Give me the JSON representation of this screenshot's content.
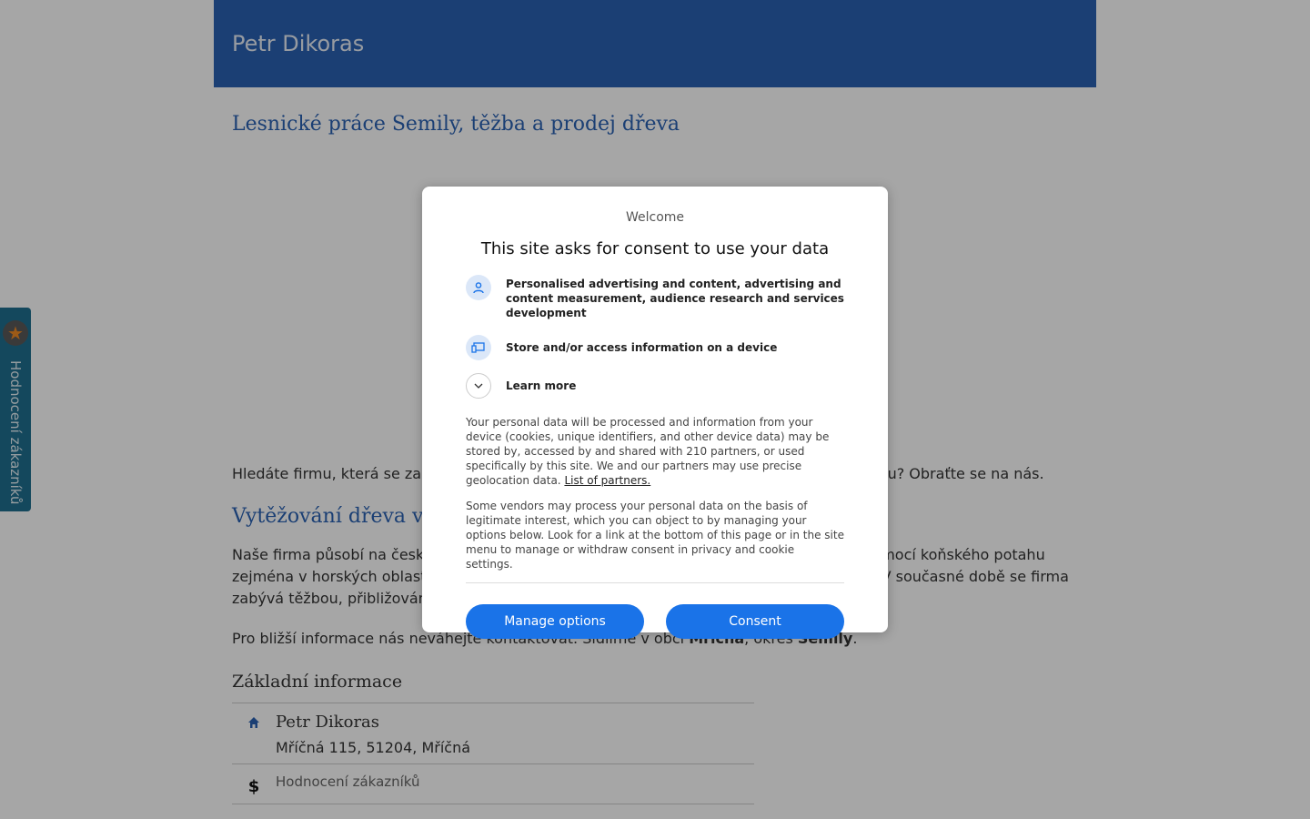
{
  "header": {
    "site_title": "Petr Dikoras"
  },
  "main": {
    "heading": "Lesnické práce Semily, těžba a prodej dřeva",
    "intro": "Hledáte firmu, která se zabývá lesnickými pracemi a dokáže si poradit i v náročném terénu? Obraťte se na nás.",
    "subheading": "Vytěžování dřeva v Semilech",
    "company_text": "Naše firma působí na českém trhu již mnoho let. Specializujeme se na vyvážení dřeva pomocí koňského potahu zejména v horských oblastech a náročném terénu. Vlastníme rovněž vyvážecí soupravu. V současné době se firma zabývá těžbou, přibližováním a prodejem dřeva.",
    "contact_text_before": "Pro bližší informace nás neváhejte kontaktovat. Sídlíme v obci ",
    "contact_village": "Mříčná",
    "contact_text_mid": ", okres ",
    "contact_district": "Semily",
    "contact_text_end": "."
  },
  "info": {
    "heading": "Základní informace",
    "name": "Petr Dikoras",
    "address": "Mříčná 115, 51204, Mříčná",
    "rating_label": "Hodnocení zákazníků"
  },
  "side_tab": {
    "label": "Hodnocení zákazníků"
  },
  "consent": {
    "welcome": "Welcome",
    "title": "This site asks for consent to use your data",
    "purpose_1": "Personalised advertising and content, advertising and content measurement, audience research and services development",
    "purpose_2": "Store and/or access information on a device",
    "learn_more": "Learn more",
    "body_1": "Your personal data will be processed and information from your device (cookies, unique identifiers, and other device data) may be stored by, accessed by and shared with 210 partners, or used specifically by this site. We and our partners may use precise geolocation data. ",
    "partners_link": "List of partners.",
    "body_2": "Some vendors may process your personal data on the basis of legitimate interest, which you can object to by managing your options below. Look for a link at the bottom of this page or in the site menu to manage or withdraw consent in privacy and cookie settings.",
    "manage_button": "Manage options",
    "consent_button": "Consent"
  },
  "colors": {
    "header_bg": "#2a62b3",
    "heading_blue": "#2a62b3",
    "button_blue": "#1a73e8",
    "side_tab_bg": "#1f6f8f"
  },
  "icons": {
    "purpose_1": "person-icon",
    "purpose_2": "device-icon",
    "learn_more": "chevron-down-icon",
    "address": "home-icon",
    "rating": "dollar-icon",
    "side_tab": "star-icon"
  }
}
